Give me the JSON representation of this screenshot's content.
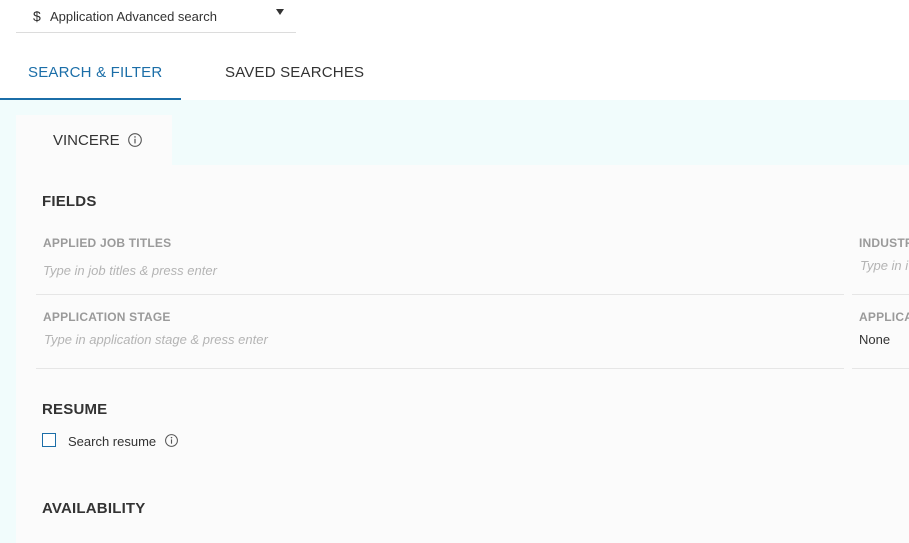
{
  "selector": {
    "currency_icon": "dollar-icon",
    "label": "Application Advanced search",
    "caret_icon": "caret-down-icon"
  },
  "tabs": [
    {
      "label": "SEARCH & FILTER",
      "active": true
    },
    {
      "label": "SAVED SEARCHES",
      "active": false
    }
  ],
  "subtab": {
    "label": "VINCERE",
    "icon": "info-icon"
  },
  "sections": {
    "fields": {
      "title": "FIELDS",
      "applied_job_titles": {
        "label": "APPLIED JOB TITLES",
        "placeholder": "Type in job titles & press enter"
      },
      "industry": {
        "label": "INDUSTR",
        "placeholder": "Type in i"
      },
      "application_stage": {
        "label": "APPLICATION STAGE",
        "placeholder": "Type in application stage & press enter"
      },
      "application_right": {
        "label": "APPLICA",
        "value": "None"
      }
    },
    "resume": {
      "title": "RESUME",
      "checkbox_label": "Search resume",
      "checked": false,
      "icon": "info-icon"
    },
    "availability": {
      "title": "AVAILABILITY"
    }
  },
  "colors": {
    "accent": "#1b6ea8",
    "panel_bg": "#f1fcfc",
    "content_bg": "#fbfbfb"
  }
}
